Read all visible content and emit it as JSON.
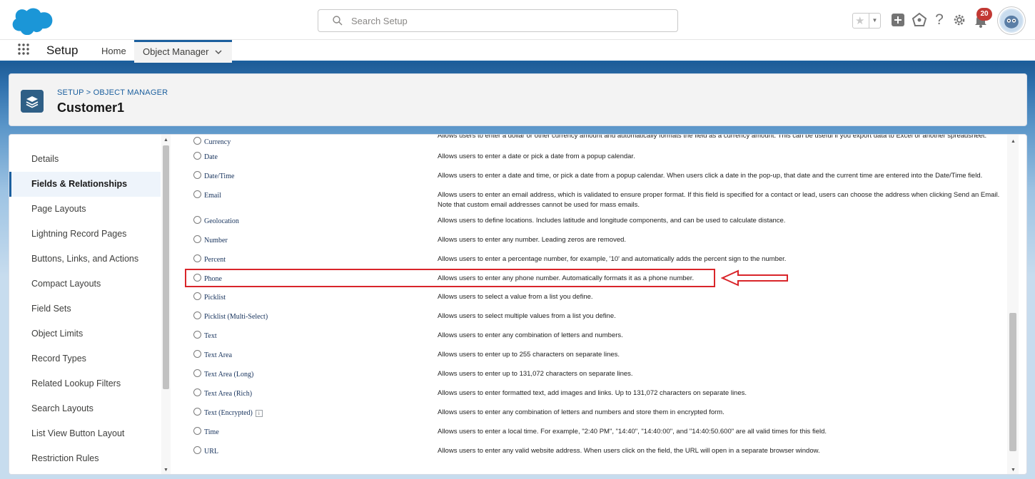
{
  "header": {
    "search_placeholder": "Search Setup",
    "notification_count": "20",
    "icons": [
      "star-icon",
      "chevron-down-icon",
      "add-icon",
      "trailhead-icon",
      "help-icon",
      "gear-icon",
      "bell-icon",
      "avatar"
    ]
  },
  "nav": {
    "app_name": "Setup",
    "tabs": [
      {
        "label": "Home"
      },
      {
        "label": "Object Manager"
      }
    ]
  },
  "object": {
    "breadcrumb": "SETUP > OBJECT MANAGER",
    "title": "Customer1"
  },
  "sidebar": {
    "items": [
      {
        "label": "Details"
      },
      {
        "label": "Fields & Relationships",
        "active": true
      },
      {
        "label": "Page Layouts"
      },
      {
        "label": "Lightning Record Pages"
      },
      {
        "label": "Buttons, Links, and Actions"
      },
      {
        "label": "Compact Layouts"
      },
      {
        "label": "Field Sets"
      },
      {
        "label": "Object Limits"
      },
      {
        "label": "Record Types"
      },
      {
        "label": "Related Lookup Filters"
      },
      {
        "label": "Search Layouts"
      },
      {
        "label": "List View Button Layout"
      },
      {
        "label": "Restriction Rules"
      }
    ]
  },
  "field_types": [
    {
      "name": "Currency",
      "desc": "Allows users to enter a dollar or other currency amount and automatically formats the field as a currency amount. This can be useful if you export data to Excel or another spreadsheet."
    },
    {
      "name": "Date",
      "desc": "Allows users to enter a date or pick a date from a popup calendar."
    },
    {
      "name": "Date/Time",
      "desc": "Allows users to enter a date and time, or pick a date from a popup calendar. When users click a date in the pop-up, that date and the current time are entered into the Date/Time field."
    },
    {
      "name": "Email",
      "desc": "Allows users to enter an email address, which is validated to ensure proper format. If this field is specified for a contact or lead, users can choose the address when clicking Send an Email. Note that custom email addresses cannot be used for mass emails."
    },
    {
      "name": "Geolocation",
      "desc": "Allows users to define locations. Includes latitude and longitude components, and can be used to calculate distance."
    },
    {
      "name": "Number",
      "desc": "Allows users to enter any number. Leading zeros are removed."
    },
    {
      "name": "Percent",
      "desc": "Allows users to enter a percentage number, for example, '10' and automatically adds the percent sign to the number."
    },
    {
      "name": "Phone",
      "desc": "Allows users to enter any phone number. Automatically formats it as a phone number.",
      "highlighted": true
    },
    {
      "name": "Picklist",
      "desc": "Allows users to select a value from a list you define."
    },
    {
      "name": "Picklist (Multi-Select)",
      "desc": "Allows users to select multiple values from a list you define."
    },
    {
      "name": "Text",
      "desc": "Allows users to enter any combination of letters and numbers."
    },
    {
      "name": "Text Area",
      "desc": "Allows users to enter up to 255 characters on separate lines."
    },
    {
      "name": "Text Area (Long)",
      "desc": "Allows users to enter up to 131,072 characters on separate lines."
    },
    {
      "name": "Text Area (Rich)",
      "desc": "Allows users to enter formatted text, add images and links. Up to 131,072 characters on separate lines."
    },
    {
      "name": "Text (Encrypted)",
      "desc": "Allows users to enter any combination of letters and numbers and store them in encrypted form.",
      "info": true
    },
    {
      "name": "Time",
      "desc": "Allows users to enter a local time. For example, \"2:40 PM\", \"14:40\", \"14:40:00\", and \"14:40:50.600\" are all valid times for this field."
    },
    {
      "name": "URL",
      "desc": "Allows users to enter any valid website address. When users click on the field, the URL will open in a separate browser window."
    }
  ],
  "colors": {
    "brand_blue": "#1b5f9e",
    "highlight_red": "#d9252a",
    "badge_red": "#c23934"
  }
}
